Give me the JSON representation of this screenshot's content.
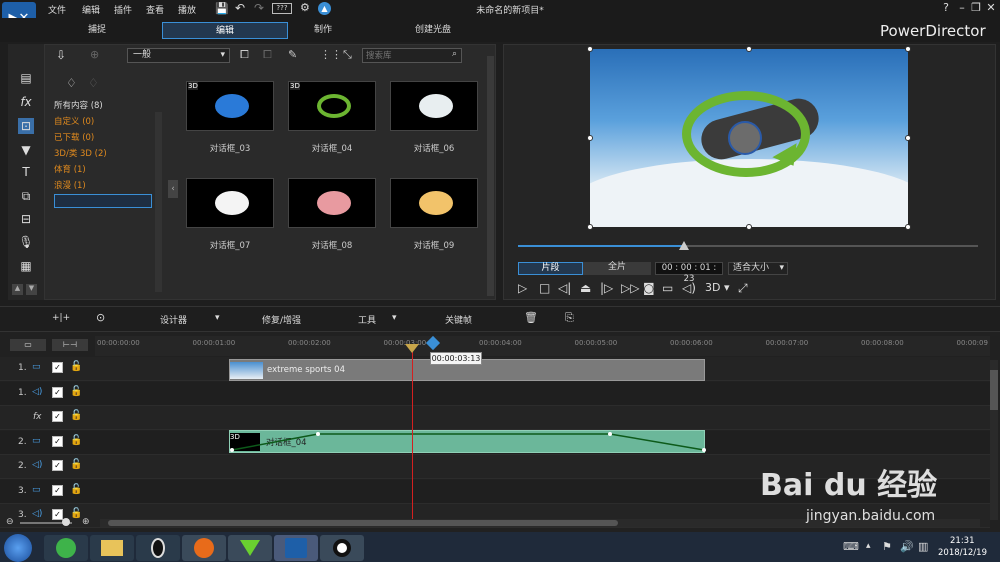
{
  "menu": [
    "文件",
    "编辑",
    "插件",
    "查看",
    "播放"
  ],
  "zoom_label": "???",
  "window_title": "未命名的新项目*",
  "modes": [
    "捕捉",
    "编辑",
    "制作",
    "创建光盘"
  ],
  "brand": "PowerDirector",
  "library": {
    "dropdown": "一般",
    "search_placeholder": "搜索库",
    "categories": [
      {
        "label": "所有内容 (8)",
        "color": "#dddddd"
      },
      {
        "label": "自定义  (0)",
        "color": "#e08a1e"
      },
      {
        "label": "已下载  (0)",
        "color": "#e08a1e"
      },
      {
        "label": "3D/类 3D  (2)",
        "color": "#e08a1e"
      },
      {
        "label": "体育  (1)",
        "color": "#e08a1e"
      },
      {
        "label": "浪漫  (1)",
        "color": "#e08a1e"
      },
      {
        "label": "一般  (6)",
        "color": "#e08a1e"
      }
    ],
    "items": [
      {
        "label": "对话框_03",
        "badge": "3D"
      },
      {
        "label": "对话框_04",
        "badge": "3D"
      },
      {
        "label": "对话框_06",
        "badge": ""
      },
      {
        "label": "对话框_07",
        "badge": ""
      },
      {
        "label": "对话框_08",
        "badge": ""
      },
      {
        "label": "对话框_09",
        "badge": ""
      }
    ]
  },
  "preview": {
    "tab_clip": "片段",
    "tab_full": "全片",
    "timecode": "00 : 00 : 01 : 23",
    "fit": "适合大小",
    "three_d": "3D",
    "progress_fraction": 0.36
  },
  "toolbar": {
    "designer": "设计器",
    "repair": "修复/增强",
    "tools": "工具",
    "keyframe": "关键帧"
  },
  "ruler": [
    "00:00:00:00",
    "00:00:01:00",
    "00:00:02:00",
    "00:00:03:00",
    "00:00:04:00",
    "00:00:05:00",
    "00:00:06:00",
    "00:00:07:00",
    "00:00:08:00",
    "00:00:09"
  ],
  "playhead_time": "00:00:03:13",
  "tracks": [
    "1.",
    "1.",
    "fx",
    "2.",
    "2.",
    "3.",
    "3."
  ],
  "clips": {
    "video": "extreme sports 04",
    "overlay": "对话框_04",
    "overlay_badge": "3D"
  },
  "clock": {
    "time": "21:31",
    "date": "2018/12/19"
  },
  "watermark": {
    "brand": "Bai du 经验",
    "url": "jingyan.baidu.com"
  },
  "colors": {
    "accent": "#3a8fd6",
    "overlay_clip": "#6bb79a",
    "video_clip": "#7a7a7a",
    "playhead": "#d32020"
  }
}
